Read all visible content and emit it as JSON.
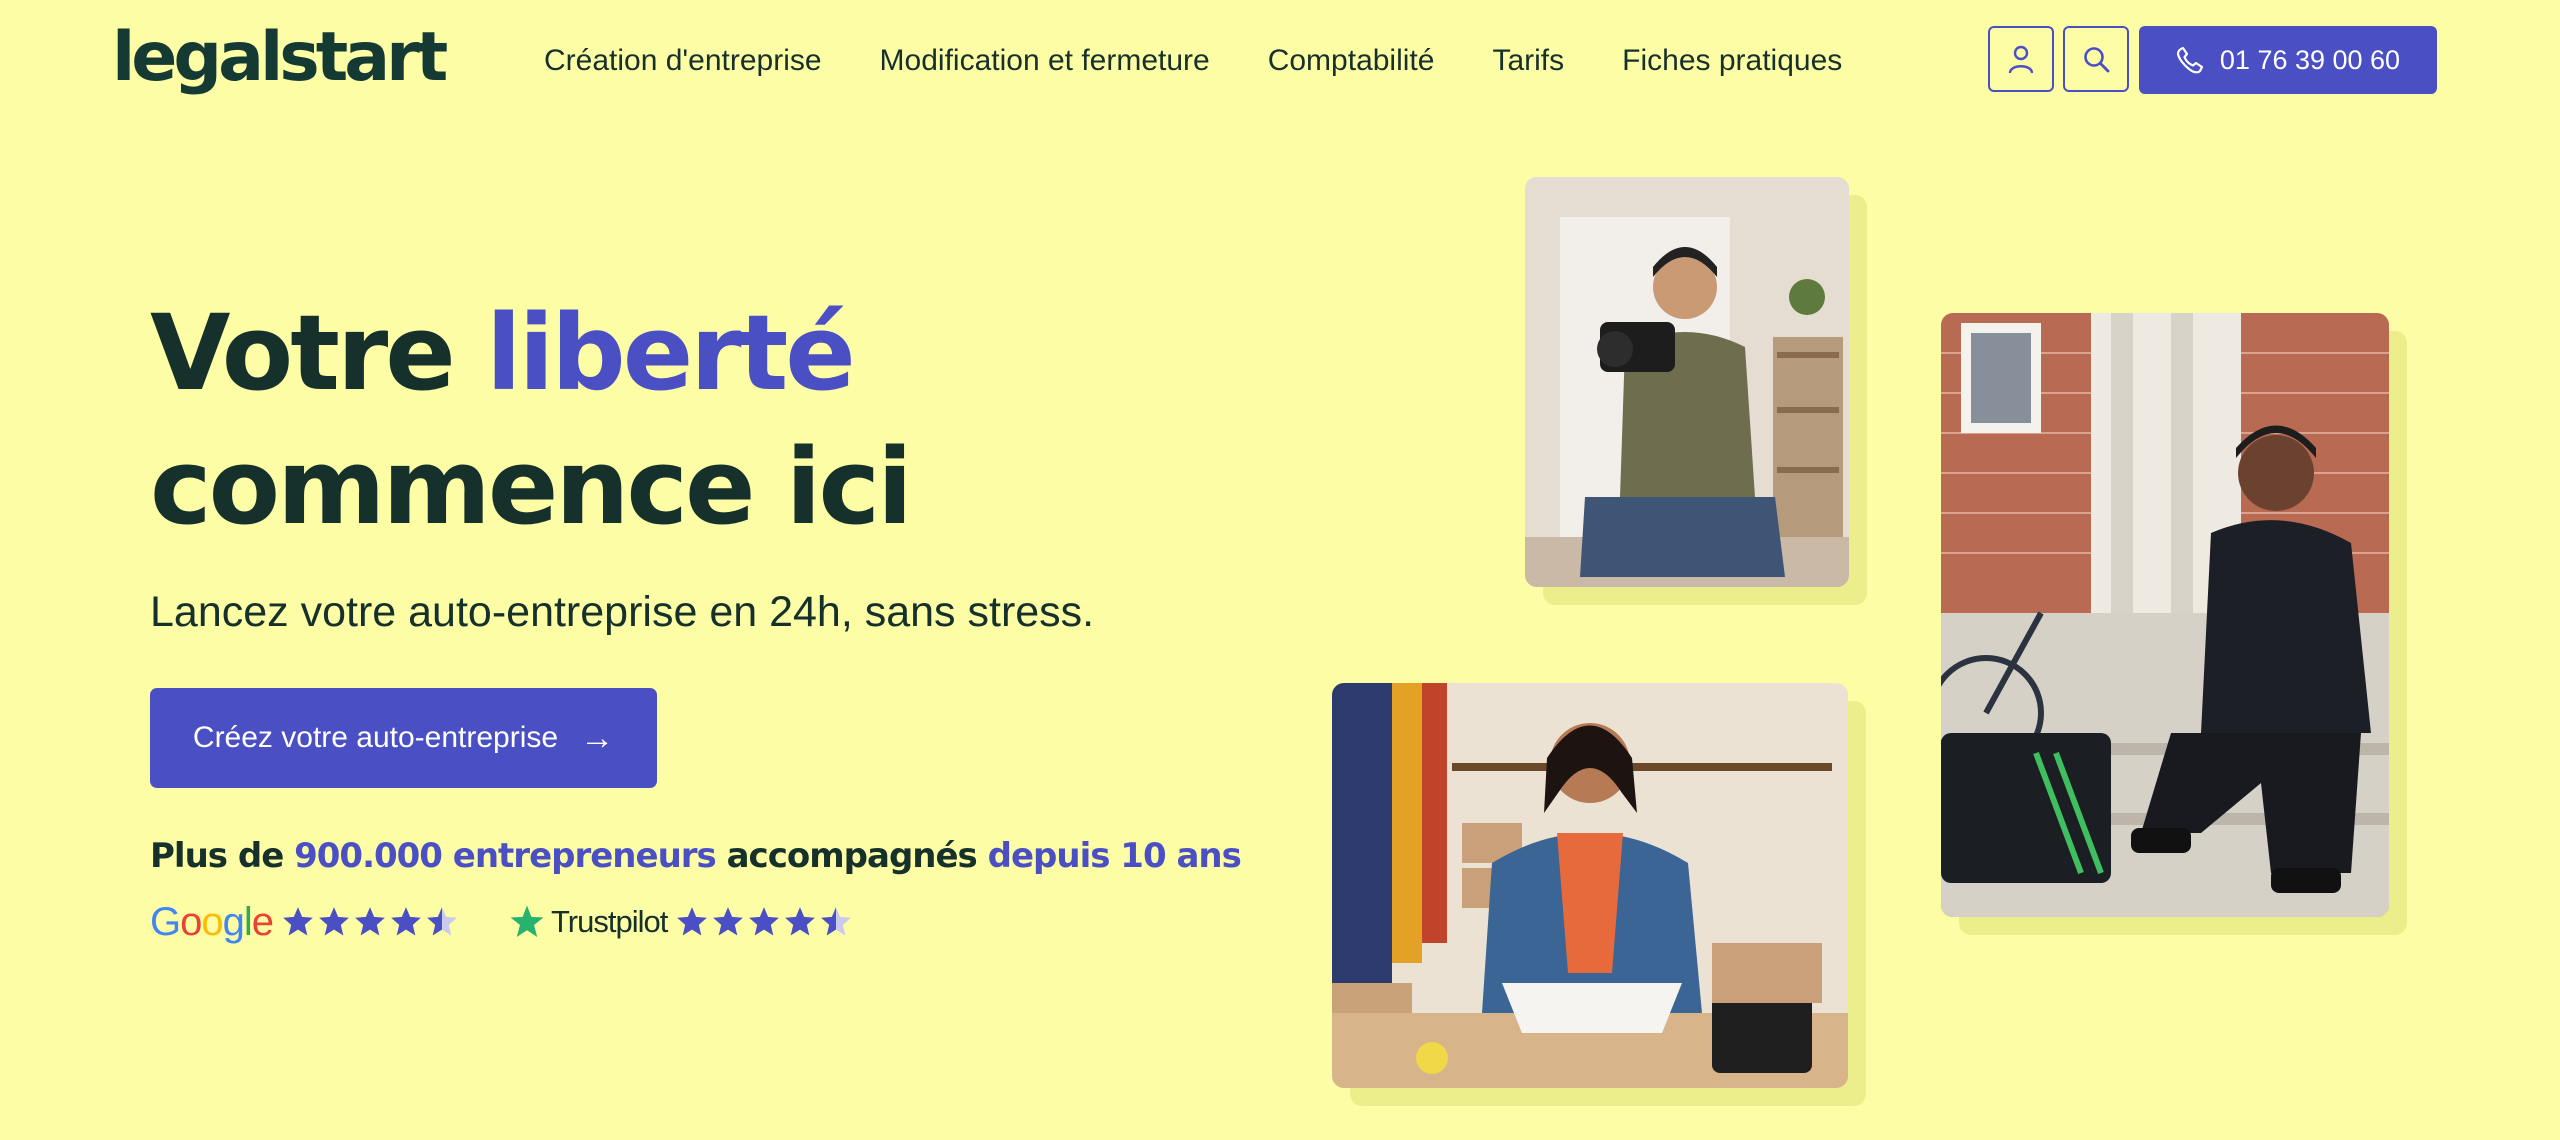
{
  "header": {
    "logo": "legalstart",
    "nav": [
      "Création d'entreprise",
      "Modification et fermeture",
      "Comptabilité",
      "Tarifs",
      "Fiches pratiques"
    ],
    "account_icon": "user-icon",
    "search_icon": "search-icon",
    "phone_icon": "phone-icon",
    "phone": "01 76 39 00 60"
  },
  "hero": {
    "title_part1": "Votre ",
    "title_accent": "liberté",
    "title_line2": "commence ici",
    "subtitle": "Lancez votre auto-entreprise en 24h, sans stress.",
    "cta_label": "Créez votre auto-entreprise",
    "cta_arrow": "→",
    "proof": {
      "p1": "Plus de ",
      "p2": "900.000 entrepreneurs",
      "p3": " accompagnés ",
      "p4": "depuis 10 ans"
    },
    "ratings": [
      {
        "source": "Google",
        "stars": 4.5
      },
      {
        "source": "Trustpilot",
        "stars": 4.5
      }
    ]
  },
  "colors": {
    "background": "#fdfda6",
    "accent": "#4a50c4",
    "text": "#16302b",
    "card_shadow": "#ebee8a"
  }
}
